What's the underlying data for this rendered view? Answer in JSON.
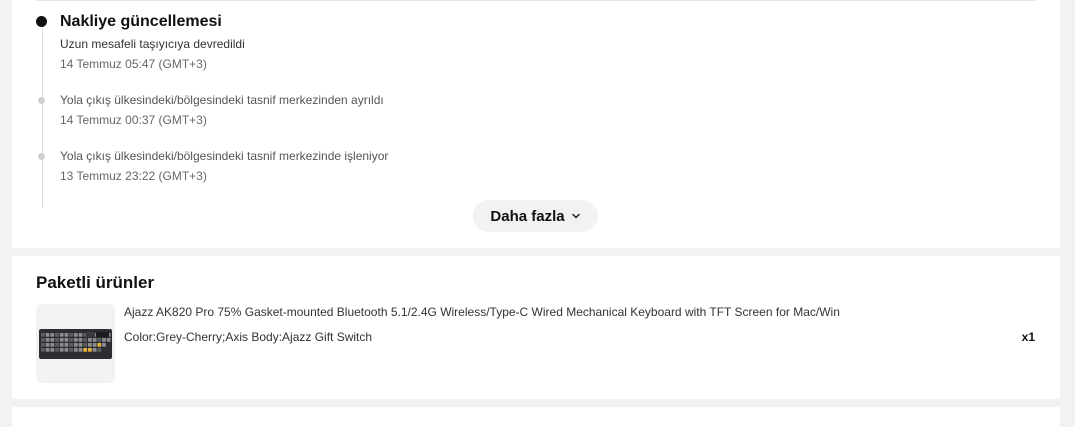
{
  "tracking": {
    "events": [
      {
        "title": "Nakliye güncellemesi",
        "text": "Uzun mesafeli taşıyıcıya devredildi",
        "time": "14 Temmuz 05:47 (GMT+3)"
      },
      {
        "text": "Yola çıkış ülkesindeki/bölgesindeki tasnif merkezinden ayrıldı",
        "time": "14 Temmuz 00:37 (GMT+3)"
      },
      {
        "text": "Yola çıkış ülkesindeki/bölgesindeki tasnif merkezinde işleniyor",
        "time": "13 Temmuz 23:22 (GMT+3)"
      }
    ],
    "more_label": "Daha fazla"
  },
  "products": {
    "title": "Paketli ürünler",
    "items": [
      {
        "name": "Ajazz AK820 Pro 75% Gasket-mounted Bluetooth 5.1/2.4G Wireless/Type-C Wired Mechanical Keyboard with TFT Screen for Mac/Win",
        "variant": "Color:Grey-Cherry;Axis Body:Ajazz Gift Switch",
        "quantity": "x1",
        "image_icon": "keyboard-icon"
      }
    ]
  }
}
